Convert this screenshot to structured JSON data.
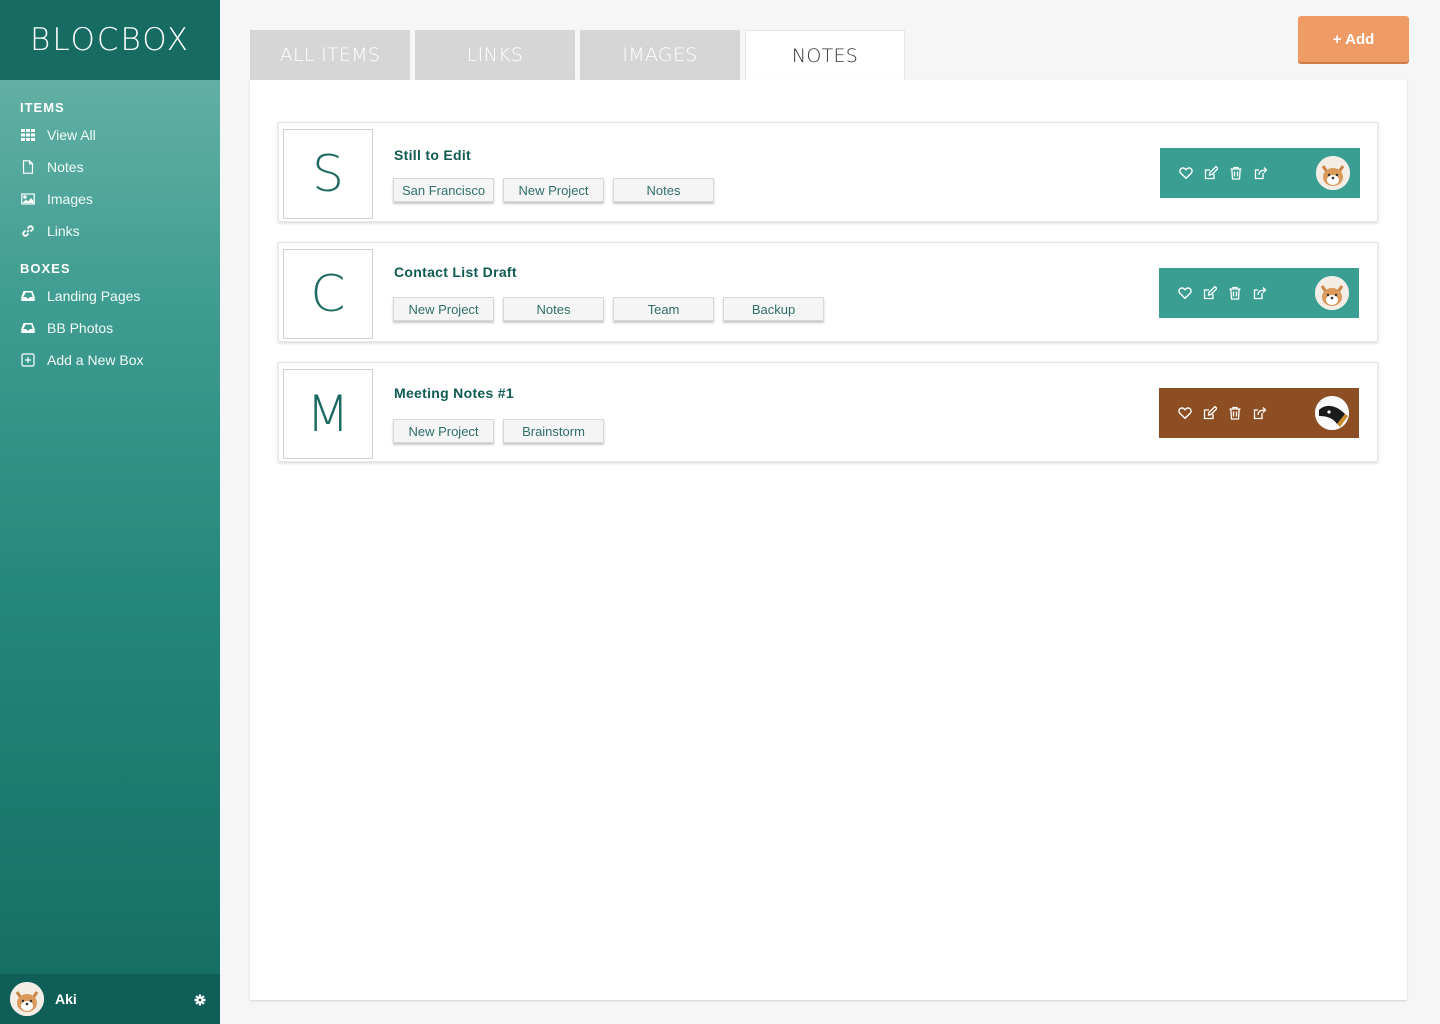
{
  "app": {
    "logo": "BLOCBOX"
  },
  "sidebar": {
    "items_title": "ITEMS",
    "items": [
      {
        "label": "View All",
        "icon": "grid-icon"
      },
      {
        "label": "Notes",
        "icon": "file-icon"
      },
      {
        "label": "Images",
        "icon": "image-icon"
      },
      {
        "label": "Links",
        "icon": "link-icon"
      }
    ],
    "boxes_title": "BOXES",
    "boxes": [
      {
        "label": "Landing Pages",
        "icon": "inbox-icon"
      },
      {
        "label": "BB Photos",
        "icon": "inbox-icon"
      },
      {
        "label": "Add a New Box",
        "icon": "plus-square-icon"
      }
    ],
    "user": {
      "name": "Aki"
    }
  },
  "tabs": [
    {
      "label": "ALL ITEMS",
      "active": false
    },
    {
      "label": "LINKS",
      "active": false
    },
    {
      "label": "IMAGES",
      "active": false
    },
    {
      "label": "NOTES",
      "active": true
    }
  ],
  "add_button": "+ Add",
  "colors": {
    "accent": "#3a9e92",
    "brown": "#8e4e23",
    "orange": "#ef9b66",
    "sidebar_dark": "#166b63"
  },
  "notes": [
    {
      "letter": "S",
      "title": "Still to Edit",
      "tags": [
        "San Francisco",
        "New Project",
        "Notes"
      ],
      "bar_color": "#3a9e92",
      "avatar": "dog"
    },
    {
      "letter": "C",
      "title": "Contact List Draft",
      "tags": [
        "New Project",
        "Notes",
        "Team",
        "Backup"
      ],
      "bar_color": "#3a9e92",
      "avatar": "dog"
    },
    {
      "letter": "M",
      "title": "Meeting Notes #1",
      "tags": [
        "New Project",
        "Brainstorm"
      ],
      "bar_color": "#8e4e23",
      "avatar": "bird"
    }
  ]
}
